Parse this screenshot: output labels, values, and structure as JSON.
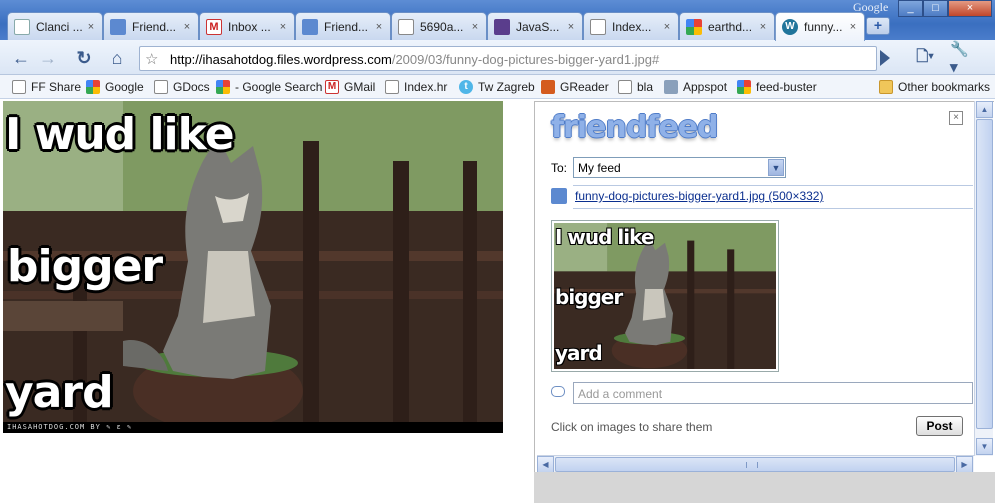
{
  "window": {
    "google_label": "Google",
    "controls": [
      "_",
      "□",
      "×"
    ]
  },
  "tabs": [
    {
      "label": "Clanci ...",
      "icon": "document-icon",
      "active": false
    },
    {
      "label": "Friend...",
      "icon": "friendfeed-icon",
      "active": false
    },
    {
      "label": "Inbox ...",
      "icon": "gmail-icon",
      "active": false
    },
    {
      "label": "Friend...",
      "icon": "friendfeed-icon",
      "active": false
    },
    {
      "label": "5690a...",
      "icon": "page-icon",
      "active": false
    },
    {
      "label": "JavaS...",
      "icon": "javascript-icon",
      "active": false
    },
    {
      "label": "Index...",
      "icon": "page-icon",
      "active": false
    },
    {
      "label": "earthd...",
      "icon": "google-icon",
      "active": false
    },
    {
      "label": "funny...",
      "icon": "wordpress-icon",
      "active": true
    }
  ],
  "toolbar": {
    "url_host": "http://ihasahotdog.files.wordpress.com",
    "url_path": "/2009/03/funny-dog-pictures-bigger-yard1.jpg#"
  },
  "bookmarks": [
    {
      "label": "FF Share",
      "icon": "page-icon"
    },
    {
      "label": "Google",
      "icon": "google-icon"
    },
    {
      "label": "GDocs",
      "icon": "page-icon"
    },
    {
      "label": "- Google Search",
      "icon": "google-icon"
    },
    {
      "label": "GMail",
      "icon": "gmail-icon"
    },
    {
      "label": "Index.hr",
      "icon": "page-icon"
    },
    {
      "label": "Tw Zagreb",
      "icon": "twitter-icon"
    },
    {
      "label": "GReader",
      "icon": "rss-icon"
    },
    {
      "label": "bla",
      "icon": "page-icon"
    },
    {
      "label": "Appspot",
      "icon": "appspot-icon"
    },
    {
      "label": "feed-buster",
      "icon": "google-icon"
    }
  ],
  "other_bookmarks": "Other bookmarks",
  "image": {
    "caption_lines": [
      "I wud like",
      "bigger",
      "yard"
    ],
    "watermark": "IHASAHOTDOG.COM BY ✎ ε ✎"
  },
  "friendfeed": {
    "logo": "friendfeed",
    "close": "×",
    "to_label": "To:",
    "to_value": "My feed",
    "link_text": "funny-dog-pictures-bigger-yard1.jpg (500×332)",
    "comment_placeholder": "Add a comment",
    "hint": "Click on images to share them",
    "post_label": "Post"
  },
  "colors": {
    "tab_strip": "#3a6fc0",
    "link": "#0b2f8f",
    "friendfeed_blue": "#8fb1e8"
  }
}
